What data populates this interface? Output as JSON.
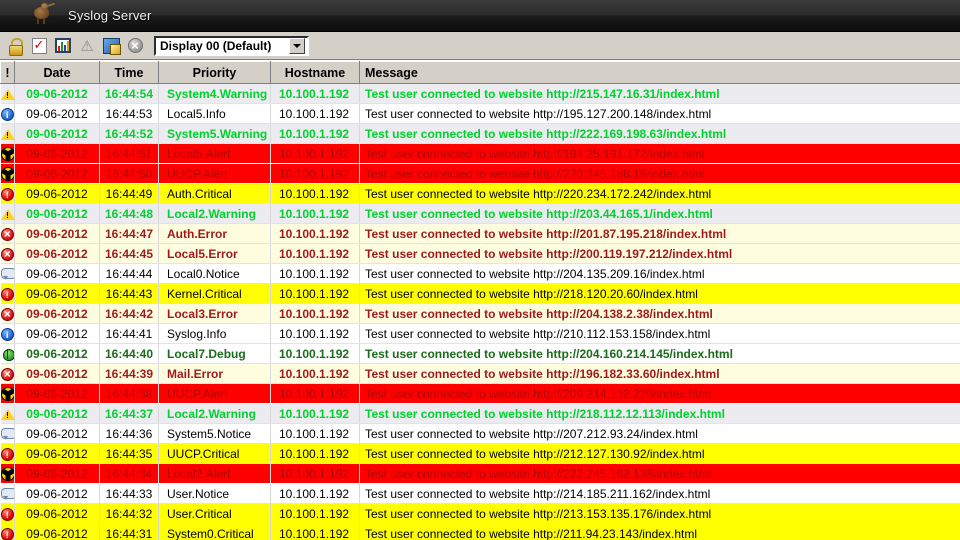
{
  "window": {
    "title": "Syslog Server",
    "app_icon": "kiwi-bird-icon"
  },
  "toolbar": {
    "buttons": [
      {
        "name": "lock-icon",
        "label": "Lock"
      },
      {
        "name": "checkmark-icon",
        "label": "Setup"
      },
      {
        "name": "bar-chart-icon",
        "label": "Statistics"
      },
      {
        "name": "warning-triangle-icon",
        "label": "Alarms"
      },
      {
        "name": "edit-display-icon",
        "label": "Edit Display"
      },
      {
        "name": "cancel-icon",
        "label": "Cancel"
      }
    ],
    "display_select": {
      "value": "Display 00 (Default)",
      "arrow": "chevron-down-icon"
    }
  },
  "grid": {
    "columns": [
      "!",
      "Date",
      "Time",
      "Priority",
      "Hostname",
      "Message"
    ],
    "rows": [
      {
        "severity": "warning",
        "icon": "warning-triangle-icon",
        "date": "09-06-2012",
        "time": "16:44:54",
        "priority": "System4.Warning",
        "hostname": "10.100.1.192",
        "message": "Test user connected to website http://215.147.16.31/index.html"
      },
      {
        "severity": "info",
        "icon": "info-circle-icon",
        "date": "09-06-2012",
        "time": "16:44:53",
        "priority": "Local5.Info",
        "hostname": "10.100.1.192",
        "message": "Test user connected to website http://195.127.200.148/index.html"
      },
      {
        "severity": "warning",
        "icon": "warning-triangle-icon",
        "date": "09-06-2012",
        "time": "16:44:52",
        "priority": "System5.Warning",
        "hostname": "10.100.1.192",
        "message": "Test user connected to website http://222.169.198.63/index.html"
      },
      {
        "severity": "alert",
        "icon": "radiation-icon",
        "date": "09-06-2012",
        "time": "16:44:51",
        "priority": "Local5.Alert",
        "hostname": "10.100.1.192",
        "message": "Test user connected to website http://194.25.191.172/index.html"
      },
      {
        "severity": "alert",
        "icon": "radiation-icon",
        "date": "09-06-2012",
        "time": "16:44:50",
        "priority": "UUCP.Alert",
        "hostname": "10.100.1.192",
        "message": "Test user connected to website http://220.245.188.16/index.html"
      },
      {
        "severity": "critical",
        "icon": "critical-circle-icon",
        "date": "09-06-2012",
        "time": "16:44:49",
        "priority": "Auth.Critical",
        "hostname": "10.100.1.192",
        "message": "Test user connected to website http://220.234.172.242/index.html"
      },
      {
        "severity": "warning",
        "icon": "warning-triangle-icon",
        "date": "09-06-2012",
        "time": "16:44:48",
        "priority": "Local2.Warning",
        "hostname": "10.100.1.192",
        "message": "Test user connected to website http://203.44.165.1/index.html"
      },
      {
        "severity": "error",
        "icon": "error-circle-icon",
        "date": "09-06-2012",
        "time": "16:44:47",
        "priority": "Auth.Error",
        "hostname": "10.100.1.192",
        "message": "Test user connected to website http://201.87.195.218/index.html"
      },
      {
        "severity": "error",
        "icon": "error-circle-icon",
        "date": "09-06-2012",
        "time": "16:44:45",
        "priority": "Local5.Error",
        "hostname": "10.100.1.192",
        "message": "Test user connected to website http://200.119.197.212/index.html"
      },
      {
        "severity": "notice",
        "icon": "speech-bubble-icon",
        "date": "09-06-2012",
        "time": "16:44:44",
        "priority": "Local0.Notice",
        "hostname": "10.100.1.192",
        "message": "Test user connected to website http://204.135.209.16/index.html"
      },
      {
        "severity": "critical",
        "icon": "critical-circle-icon",
        "date": "09-06-2012",
        "time": "16:44:43",
        "priority": "Kernel.Critical",
        "hostname": "10.100.1.192",
        "message": "Test user connected to website http://218.120.20.60/index.html"
      },
      {
        "severity": "error",
        "icon": "error-circle-icon",
        "date": "09-06-2012",
        "time": "16:44:42",
        "priority": "Local3.Error",
        "hostname": "10.100.1.192",
        "message": "Test user connected to website http://204.138.2.38/index.html"
      },
      {
        "severity": "info",
        "icon": "info-circle-icon",
        "date": "09-06-2012",
        "time": "16:44:41",
        "priority": "Syslog.Info",
        "hostname": "10.100.1.192",
        "message": "Test user connected to website http://210.112.153.158/index.html"
      },
      {
        "severity": "debug",
        "icon": "bug-icon",
        "date": "09-06-2012",
        "time": "16:44:40",
        "priority": "Local7.Debug",
        "hostname": "10.100.1.192",
        "message": "Test user connected to website http://204.160.214.145/index.html"
      },
      {
        "severity": "error",
        "icon": "error-circle-icon",
        "date": "09-06-2012",
        "time": "16:44:39",
        "priority": "Mail.Error",
        "hostname": "10.100.1.192",
        "message": "Test user connected to website http://196.182.33.60/index.html"
      },
      {
        "severity": "alert",
        "icon": "radiation-icon",
        "date": "09-06-2012",
        "time": "16:44:38",
        "priority": "UUCP.Alert",
        "hostname": "10.100.1.192",
        "message": "Test user connected to website http://209.214.132.220/index.html"
      },
      {
        "severity": "warning",
        "icon": "warning-triangle-icon",
        "date": "09-06-2012",
        "time": "16:44:37",
        "priority": "Local2.Warning",
        "hostname": "10.100.1.192",
        "message": "Test user connected to website http://218.112.12.113/index.html"
      },
      {
        "severity": "notice",
        "icon": "speech-bubble-icon",
        "date": "09-06-2012",
        "time": "16:44:36",
        "priority": "System5.Notice",
        "hostname": "10.100.1.192",
        "message": "Test user connected to website http://207.212.93.24/index.html"
      },
      {
        "severity": "critical",
        "icon": "critical-circle-icon",
        "date": "09-06-2012",
        "time": "16:44:35",
        "priority": "UUCP.Critical",
        "hostname": "10.100.1.192",
        "message": "Test user connected to website http://212.127.130.92/index.html"
      },
      {
        "severity": "alert",
        "icon": "radiation-icon",
        "date": "09-06-2012",
        "time": "16:44:34",
        "priority": "Local2.Alert",
        "hostname": "10.100.1.192",
        "message": "Test user connected to website http://222.245.162.138/index.html"
      },
      {
        "severity": "notice",
        "icon": "speech-bubble-icon",
        "date": "09-06-2012",
        "time": "16:44:33",
        "priority": "User.Notice",
        "hostname": "10.100.1.192",
        "message": "Test user connected to website http://214.185.211.162/index.html"
      },
      {
        "severity": "critical",
        "icon": "critical-circle-icon",
        "date": "09-06-2012",
        "time": "16:44:32",
        "priority": "User.Critical",
        "hostname": "10.100.1.192",
        "message": "Test user connected to website http://213.153.135.176/index.html"
      },
      {
        "severity": "critical",
        "icon": "critical-circle-icon",
        "date": "09-06-2012",
        "time": "16:44:31",
        "priority": "System0.Critical",
        "hostname": "10.100.1.192",
        "message": "Test user connected to website http://211.94.23.143/index.html"
      }
    ]
  },
  "colors": {
    "warning_text": "#00d22c",
    "warning_bg": "#ecebf0",
    "error_text": "#9e1a1a",
    "error_bg": "#fffde0",
    "critical_bg": "#ffff00",
    "alert_bg": "#ff0000",
    "alert_text": "#b00000",
    "debug_text": "#1a6b1a",
    "chrome_bg": "#d4d0c8",
    "titlebar_bg": "#1c1c1c"
  }
}
